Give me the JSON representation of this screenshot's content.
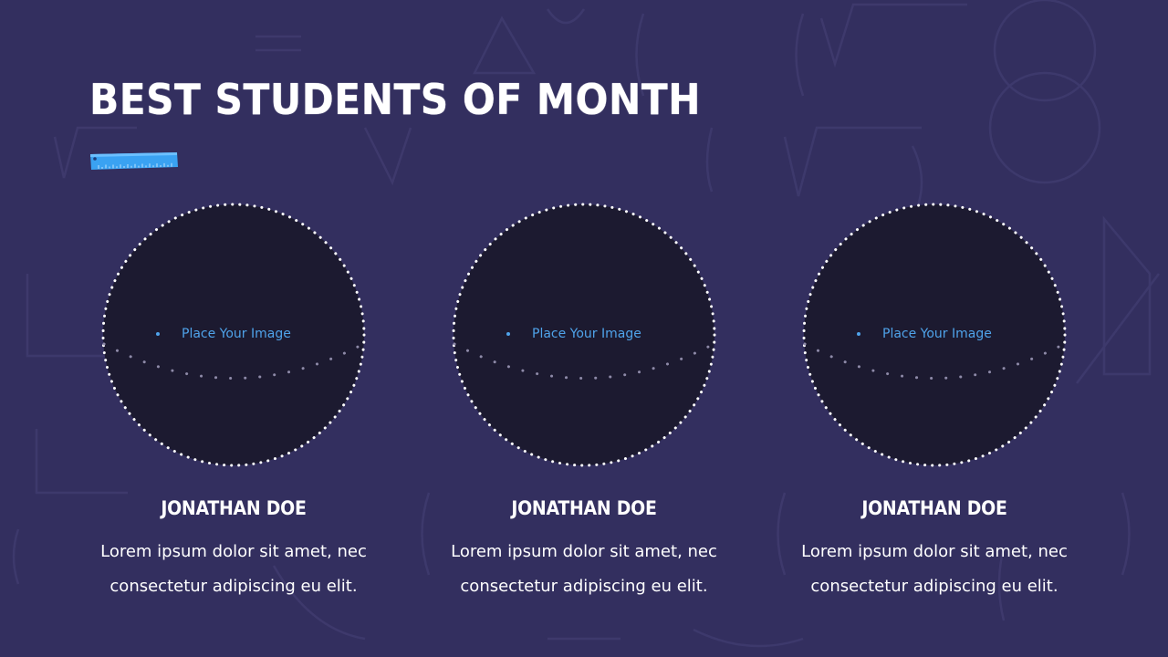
{
  "slide": {
    "title": "BEST STUDENTS OF MONTH"
  },
  "colors": {
    "background": "#332f5f",
    "photo_fill": "#1c1a30",
    "accent_blue": "#4fa3ea",
    "ruler_blue": "#3aa2f2",
    "text": "#ffffff"
  },
  "students": [
    {
      "placeholder": "Place Your Image",
      "name": "JONATHAN DOE",
      "desc_line1": "Lorem ipsum dolor sit amet, nec",
      "desc_line2": "consectetur adipiscing eu elit."
    },
    {
      "placeholder": "Place Your Image",
      "name": "JONATHAN DOE",
      "desc_line1": "Lorem ipsum dolor sit amet, nec",
      "desc_line2": "consectetur adipiscing eu elit."
    },
    {
      "placeholder": "Place Your Image",
      "name": "JONATHAN DOE",
      "desc_line1": "Lorem ipsum dolor sit amet, nec",
      "desc_line2": "consectetur adipiscing eu elit."
    }
  ]
}
